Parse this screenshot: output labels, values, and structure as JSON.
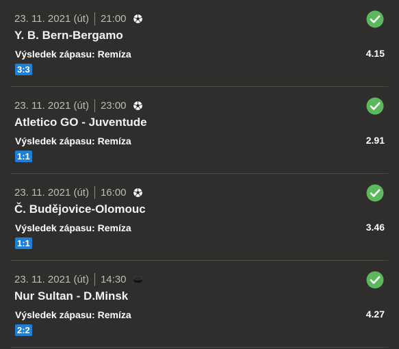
{
  "status_color": "#5cb85c",
  "score_color": "#1f7fd6",
  "bets": [
    {
      "date": "23. 11. 2021 (út)",
      "time": "21:00",
      "sport_icon": "soccer-ball-icon",
      "match": "Y. B. Bern-Bergamo",
      "market": "Výsledek zápasu: Remíza",
      "odds": "4.15",
      "score": "3:3",
      "status_icon": "check-circle-icon"
    },
    {
      "date": "23. 11. 2021 (út)",
      "time": "23:00",
      "sport_icon": "soccer-ball-icon",
      "match": "Atletico GO - Juventude",
      "market": "Výsledek zápasu: Remíza",
      "odds": "2.91",
      "score": "1:1",
      "status_icon": "check-circle-icon"
    },
    {
      "date": "23. 11. 2021 (út)",
      "time": "16:00",
      "sport_icon": "soccer-ball-icon",
      "match": "Č. Budějovice-Olomouc",
      "market": "Výsledek zápasu: Remíza",
      "odds": "3.46",
      "score": "1:1",
      "status_icon": "check-circle-icon"
    },
    {
      "date": "23. 11. 2021 (út)",
      "time": "14:30",
      "sport_icon": "hockey-puck-icon",
      "match": "Nur Sultan - D.Minsk",
      "market": "Výsledek zápasu: Remíza",
      "odds": "4.27",
      "score": "2:2",
      "status_icon": "check-circle-icon"
    }
  ]
}
